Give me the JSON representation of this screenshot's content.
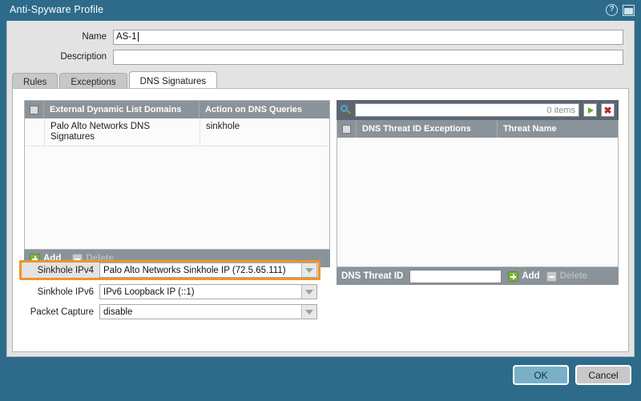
{
  "window": {
    "title": "Anti-Spyware Profile",
    "help_icon": "help-icon",
    "restore_icon": "window-restore-icon"
  },
  "form": {
    "name_label": "Name",
    "name_value": "AS-1",
    "description_label": "Description",
    "description_value": ""
  },
  "tabs": [
    {
      "label": "Rules",
      "active": false
    },
    {
      "label": "Exceptions",
      "active": false
    },
    {
      "label": "DNS Signatures",
      "active": true
    }
  ],
  "left_panel": {
    "headers": {
      "domains": "External Dynamic List Domains",
      "action": "Action on DNS Queries"
    },
    "rows": [
      {
        "domain": "Palo Alto Networks DNS Signatures",
        "action": "sinkhole"
      }
    ],
    "add_label": "Add",
    "delete_label": "Delete"
  },
  "sinkhole": {
    "ipv4_label": "Sinkhole IPv4",
    "ipv4_value": "Palo Alto Networks Sinkhole IP (72.5.65.111)",
    "ipv6_label": "Sinkhole IPv6",
    "ipv6_value": "IPv6 Loopback IP (::1)",
    "packet_capture_label": "Packet Capture",
    "packet_capture_value": "disable",
    "highlight_color": "#f0932b"
  },
  "right_panel": {
    "search_placeholder": "",
    "search_value": "",
    "item_count": "0 items",
    "go_icon": "arrow-right-icon",
    "clear_icon": "close-icon",
    "search_icon": "search-icon",
    "headers": {
      "threat_id": "DNS Threat ID Exceptions",
      "threat_name": "Threat Name"
    },
    "rows": [],
    "threat_id_label": "DNS Threat ID",
    "threat_id_value": "",
    "add_label": "Add",
    "delete_label": "Delete"
  },
  "buttons": {
    "ok": "OK",
    "cancel": "Cancel"
  }
}
